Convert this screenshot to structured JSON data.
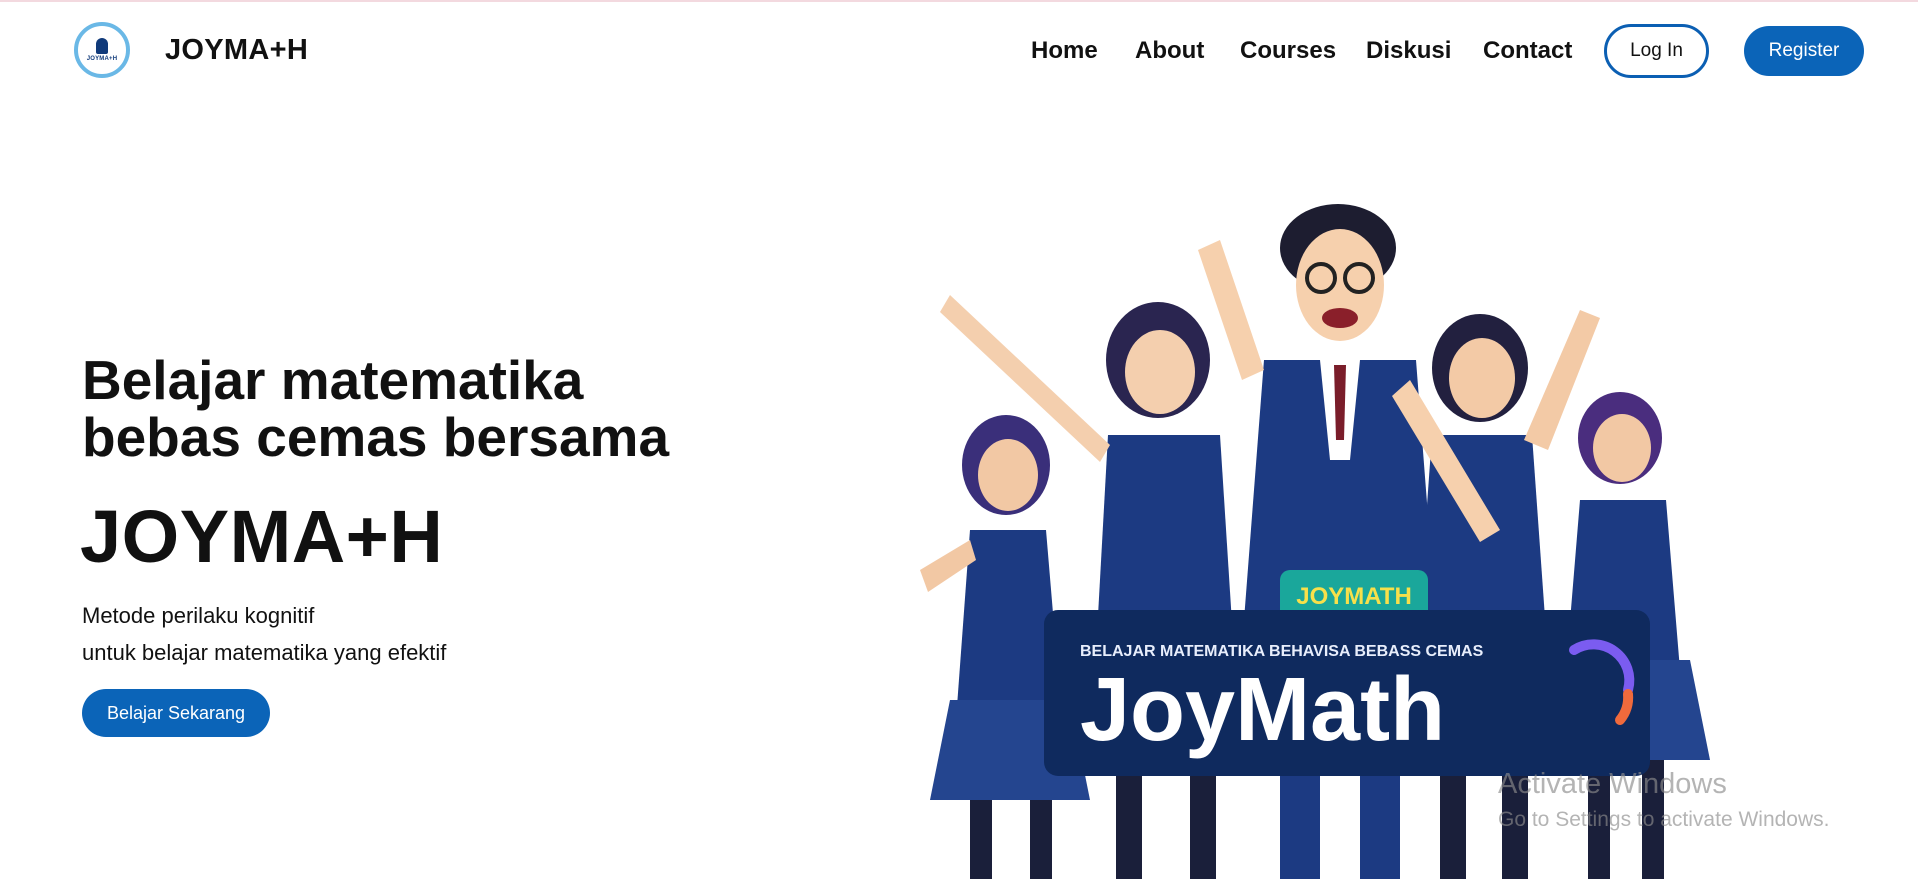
{
  "navbar": {
    "brand": "JOYMA+H",
    "logo_text": "JOYMA+H",
    "links": [
      "Home",
      "About",
      "Courses",
      "Diskusi",
      "Contact"
    ],
    "login_label": "Log In",
    "register_label": "Register"
  },
  "hero": {
    "title_line1": "Belajar matematika",
    "title_line2": "bebas cemas bersama",
    "brand": "JOYMA+H",
    "subtitle_line1": "Metode perilaku kognitif",
    "subtitle_line2": "untuk belajar matematika yang efektif",
    "cta_label": "Belajar Sekarang"
  },
  "illustration": {
    "badge_text": "JOYMATH",
    "banner_tagline": "BELAJAR MATEMATIKA BEHAVISA BEBASS CEMAS",
    "banner_title": "JoyMath"
  },
  "watermark": {
    "line1": "Activate Windows",
    "line2": "Go to Settings to activate Windows."
  },
  "colors": {
    "primary": "#0b64b8",
    "logo_ring": "#6ab8e6",
    "banner_bg": "#0f2a5e",
    "uniform": "#1c3a82"
  }
}
